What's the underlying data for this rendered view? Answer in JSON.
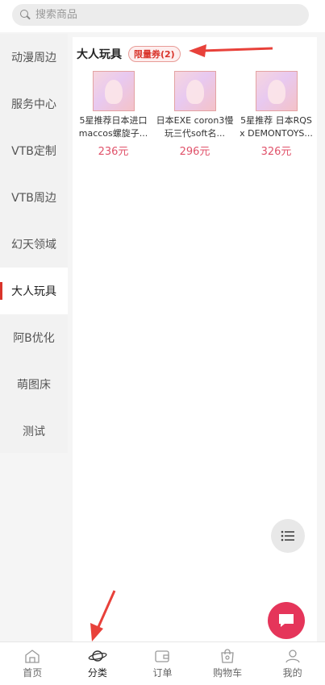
{
  "search": {
    "placeholder": "搜索商品"
  },
  "sidebar": {
    "items": [
      {
        "label": "动漫周边"
      },
      {
        "label": "服务中心"
      },
      {
        "label": "VTB定制"
      },
      {
        "label": "VTB周边"
      },
      {
        "label": "幻天领域"
      },
      {
        "label": "大人玩具"
      },
      {
        "label": "阿B优化"
      },
      {
        "label": "萌图床"
      },
      {
        "label": "测试"
      }
    ],
    "active_index": 5
  },
  "category": {
    "title": "大人玩具",
    "coupon": "限量券(2)"
  },
  "products": [
    {
      "name": "5星推荐日本进口maccos螺旋子...",
      "price": "236元"
    },
    {
      "name": "日本EXE coron3慢玩三代soft名...",
      "price": "296元"
    },
    {
      "name": "5星推荐 日本RQS x DEMONTOYS...",
      "price": "326元"
    }
  ],
  "tabbar": {
    "items": [
      {
        "label": "首页",
        "icon": "home-icon"
      },
      {
        "label": "分类",
        "icon": "planet-icon"
      },
      {
        "label": "订单",
        "icon": "wallet-icon"
      },
      {
        "label": "购物车",
        "icon": "bag-icon"
      },
      {
        "label": "我的",
        "icon": "user-icon"
      }
    ],
    "active_index": 1
  },
  "colors": {
    "accent": "#d9342b",
    "price": "#e0526a",
    "chat_button": "#e5355a",
    "annotation": "#e8413a"
  }
}
